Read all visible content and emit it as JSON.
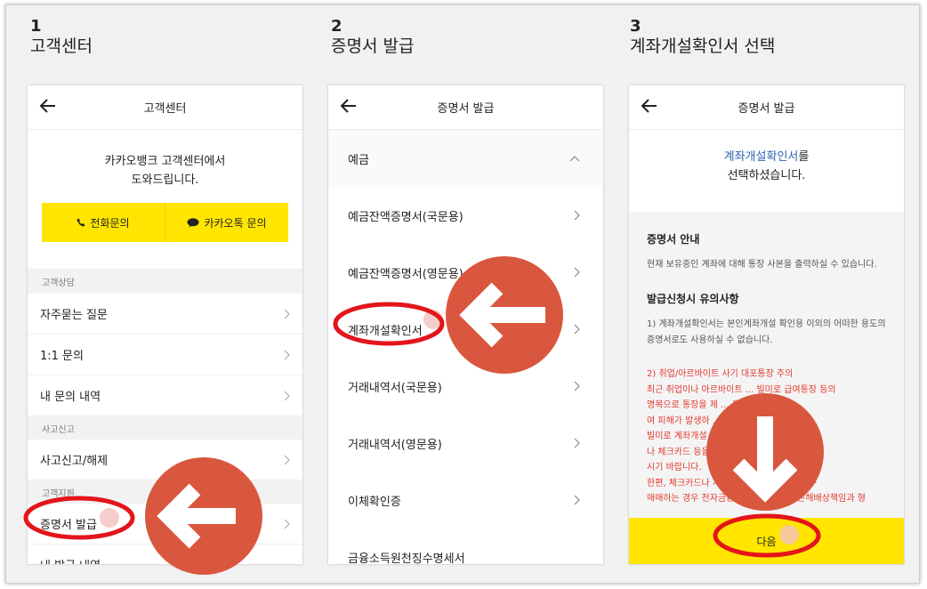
{
  "steps": [
    {
      "num": "1",
      "title": "고객센터"
    },
    {
      "num": "2",
      "title": "증명서 발급"
    },
    {
      "num": "3",
      "title": "계좌개설확인서 선택"
    }
  ],
  "screen1": {
    "header_title": "고객센터",
    "greeting_line1": "카카오뱅크 고객센터에서",
    "greeting_line2": "도와드립니다.",
    "phone_button": "전화문의",
    "kakaotalk_button": "카카오톡 문의",
    "sections": {
      "consult": "고객상담",
      "accident": "사고신고",
      "support": "고객지원"
    },
    "items": {
      "faq": "자주묻는 질문",
      "inquiry": "1:1 문의",
      "my_inquiries": "내 문의 내역",
      "report": "사고신고/해제",
      "certificate": "증명서 발급",
      "cut_off": "내 발급 내역"
    }
  },
  "screen2": {
    "header_title": "증명서 발급",
    "category": "예금",
    "items": [
      "예금잔액증명서(국문용)",
      "예금잔액증명서(영문용)",
      "계좌개설확인서",
      "거래내역서(국문용)",
      "거래내역서(영문용)",
      "이체확인증",
      "금융소득원천징수명세서"
    ]
  },
  "screen3": {
    "header_title": "증명서 발급",
    "selected_name": "계좌개설확인서",
    "selected_suffix": "를",
    "selected_line2": "선택하셨습니다.",
    "guide_heading": "증명서 안내",
    "guide_text": "현재 보유중인 계좌에 대해 통장 사본을 출력하실 수 있습니다.",
    "notice_heading": "발급신청시 유의사항",
    "notice_1": "1) 계좌개설확인서는 본인계좌개설 확인용 이외의 어떠한 용도의 증명서로도 사용하실 수 없습니다.",
    "notice_2_lines": [
      "2) 취업/아르바이트 사기 대포통장 주의",
      "최근 취업이나 아르바이트 ... 빌미로 급여통장 등의",
      "명목으로 통장을 제 ... 목적으로 사용하",
      "여 피해가 발생하 ... 급여통장을",
      "빌미로 계좌개설 ... 통장 비밀번호",
      "나 체크카드 등을 ... 기이므로 유념하",
      "시기 바랍니다.",
      "한편, 체크카드나 계좌 ... 등을 타인에게 양도·",
      "매매하는 경우 전자금융거래법 위반으로 손해배상책임과 형"
    ],
    "next_button": "다음"
  },
  "colors": {
    "accent_yellow": "#ffe500",
    "highlight_red": "#e3151b",
    "arrow_orange": "#d9573e",
    "link_blue": "#2b63b4"
  }
}
